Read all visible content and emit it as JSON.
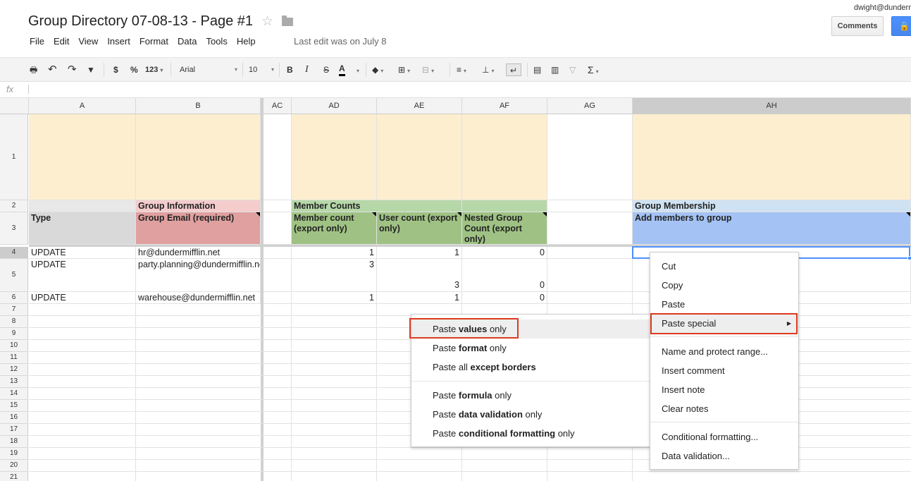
{
  "header": {
    "title": "Group Directory 07-08-13 - Page #1",
    "user": "dwight@dundermifflin.net",
    "comments_label": "Comments",
    "last_edit": "Last edit was on July 8"
  },
  "menubar": [
    "File",
    "Edit",
    "View",
    "Insert",
    "Format",
    "Data",
    "Tools",
    "Help"
  ],
  "toolbar": {
    "currency": "$",
    "percent": "%",
    "number_format": "123",
    "font": "Arial",
    "font_size": "10",
    "bold": "B",
    "italic": "I",
    "strike": "S",
    "text_color": "A",
    "functions": "Σ"
  },
  "formula_bar": {
    "fx": "fx",
    "value": ""
  },
  "columns": [
    "A",
    "B",
    "AC",
    "AD",
    "AE",
    "AF",
    "AG",
    "AH"
  ],
  "rows": [
    "1",
    "2",
    "3",
    "4",
    "5",
    "6",
    "7",
    "8",
    "9",
    "10",
    "11",
    "12",
    "13",
    "14",
    "15",
    "16",
    "17",
    "18",
    "19",
    "20",
    "21"
  ],
  "sections": {
    "group_info": "Group Information",
    "member_counts": "Member Counts",
    "group_membership": "Group Membership"
  },
  "headers": {
    "type": "Type",
    "group_email": "Group Email (required)",
    "member_count": "Member count (export only)",
    "user_count": "User count (export only)",
    "nested_count": "Nested Group Count (export only)",
    "add_members": "Add members to group"
  },
  "data_rows": [
    {
      "type": "UPDATE",
      "email": "hr@dundermifflin.net",
      "member": "1",
      "user": "1",
      "nested": "0"
    },
    {
      "type": "UPDATE",
      "email": "party.planning@dundermifflin.net",
      "member": "3",
      "user": "3",
      "nested": "0"
    },
    {
      "type": "UPDATE",
      "email": "warehouse@dundermifflin.net",
      "member": "1",
      "user": "1",
      "nested": "0"
    }
  ],
  "context_menu": {
    "cut": "Cut",
    "copy": "Copy",
    "paste": "Paste",
    "paste_special": "Paste special",
    "name_protect": "Name and protect range...",
    "insert_comment": "Insert comment",
    "insert_note": "Insert note",
    "clear_notes": "Clear notes",
    "conditional_formatting": "Conditional formatting...",
    "data_validation": "Data validation..."
  },
  "paste_special_menu": {
    "values": {
      "pre": "Paste ",
      "bold": "values",
      "post": " only"
    },
    "format": {
      "pre": "Paste ",
      "bold": "format",
      "post": " only"
    },
    "except_borders": {
      "pre": "Paste all ",
      "bold": "except borders",
      "post": ""
    },
    "formula": {
      "pre": "Paste ",
      "bold": "formula",
      "post": " only"
    },
    "data_validation": {
      "pre": "Paste ",
      "bold": "data validation",
      "post": " only"
    },
    "conditional_formatting": {
      "pre": "Paste ",
      "bold": "conditional formatting",
      "post": " only"
    }
  },
  "colors": {
    "beige": "#fdeecf",
    "pink_light": "#f4cccc",
    "pink": "#e0a0a0",
    "green_light": "#b6d7a8",
    "green": "#9fc284",
    "blue_light": "#cfe2f3",
    "blue": "#a4c2f4",
    "gray_header": "#d9d9d9",
    "highlight": "#dd3b1f"
  }
}
